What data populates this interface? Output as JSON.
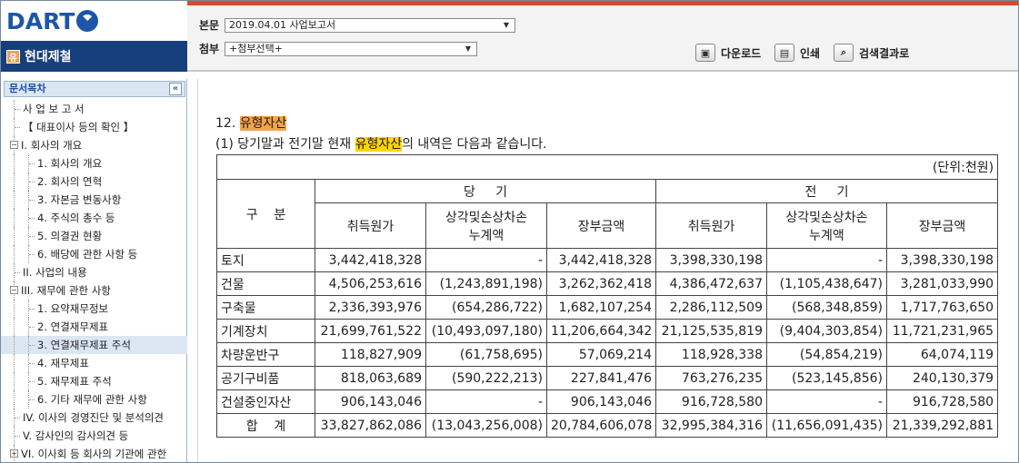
{
  "brand": {
    "logo_text": "DART",
    "company_badge": "유",
    "company_name": "현대제철"
  },
  "header": {
    "main_label": "본문",
    "main_select_value": "2019.04.01  사업보고서",
    "attach_label": "첨부",
    "attach_select_value": "+첨부선택+",
    "tools": {
      "download": "다운로드",
      "print": "인쇄",
      "search_results": "검색결과로"
    }
  },
  "sidebar": {
    "title": "문서목차",
    "collapse_glyph": "«",
    "items": [
      {
        "label": "사 업 보 고 서",
        "level": 1
      },
      {
        "label": "【 대표이사 등의 확인 】",
        "level": 1
      },
      {
        "label": "I. 회사의 개요",
        "level": 0,
        "expander": "−"
      },
      {
        "label": "1. 회사의 개요",
        "level": 2
      },
      {
        "label": "2. 회사의 연혁",
        "level": 2
      },
      {
        "label": "3. 자본금 변동사항",
        "level": 2
      },
      {
        "label": "4. 주식의 총수 등",
        "level": 2
      },
      {
        "label": "5. 의결권 현황",
        "level": 2
      },
      {
        "label": "6. 배당에 관한 사항 등",
        "level": 2
      },
      {
        "label": "II. 사업의 내용",
        "level": 1
      },
      {
        "label": "III. 재무에 관한 사항",
        "level": 0,
        "expander": "−"
      },
      {
        "label": "1. 요약재무정보",
        "level": 2
      },
      {
        "label": "2. 연결재무제표",
        "level": 2
      },
      {
        "label": "3. 연결재무제표 주석",
        "level": 2,
        "selected": true
      },
      {
        "label": "4. 재무제표",
        "level": 2
      },
      {
        "label": "5. 재무제표 주석",
        "level": 2
      },
      {
        "label": "6. 기타 재무에 관한 사항",
        "level": 2
      },
      {
        "label": "IV. 이사의 경영진단 및 분석의견",
        "level": 1
      },
      {
        "label": "V. 감사인의 감사의견 등",
        "level": 1
      },
      {
        "label": "VI. 이사회 등 회사의 기관에 관한",
        "level": 0,
        "expander": "+"
      }
    ]
  },
  "content": {
    "section_prefix": "12. ",
    "section_highlight": "유형자산",
    "desc_prefix": "(1) 당기말과 전기말 현재 ",
    "desc_highlight": "유형자산",
    "desc_suffix": "의 내역은 다음과 같습니다.",
    "table": {
      "unit": "(단위:천원)",
      "group_col_label": "구    분",
      "current_label": "당     기",
      "prior_label": "전     기",
      "sub_headers": [
        "취득원가",
        "상각및손상차손\n누계액",
        "장부금액",
        "취득원가",
        "상각및손상차손\n누계액",
        "장부금액"
      ],
      "rows": [
        {
          "name": "토지",
          "values": [
            "3,442,418,328",
            "-",
            "3,442,418,328",
            "3,398,330,198",
            "-",
            "3,398,330,198"
          ]
        },
        {
          "name": "건물",
          "values": [
            "4,506,253,616",
            "(1,243,891,198)",
            "3,262,362,418",
            "4,386,472,637",
            "(1,105,438,647)",
            "3,281,033,990"
          ]
        },
        {
          "name": "구축물",
          "values": [
            "2,336,393,976",
            "(654,286,722)",
            "1,682,107,254",
            "2,286,112,509",
            "(568,348,859)",
            "1,717,763,650"
          ]
        },
        {
          "name": "기계장치",
          "values": [
            "21,699,761,522",
            "(10,493,097,180)",
            "11,206,664,342",
            "21,125,535,819",
            "(9,404,303,854)",
            "11,721,231,965"
          ]
        },
        {
          "name": "차량운반구",
          "values": [
            "118,827,909",
            "(61,758,695)",
            "57,069,214",
            "118,928,338",
            "(54,854,219)",
            "64,074,119"
          ]
        },
        {
          "name": "공기구비품",
          "values": [
            "818,063,689",
            "(590,222,213)",
            "227,841,476",
            "763,276,235",
            "(523,145,856)",
            "240,130,379"
          ]
        },
        {
          "name": "건설중인자산",
          "values": [
            "906,143,046",
            "-",
            "906,143,046",
            "916,728,580",
            "-",
            "916,728,580"
          ]
        }
      ],
      "total": {
        "name": "합    계",
        "values": [
          "33,827,862,086",
          "(13,043,256,008)",
          "20,784,606,078",
          "32,995,384,316",
          "(11,656,091,435)",
          "21,339,292,881"
        ]
      }
    }
  },
  "colors": {
    "brand_blue": "#1d56a8",
    "company_bar": "#163f7c",
    "highlight": "#ffd400",
    "current_highlight": "#f6a24a",
    "selected_row": "#dce6f2"
  }
}
